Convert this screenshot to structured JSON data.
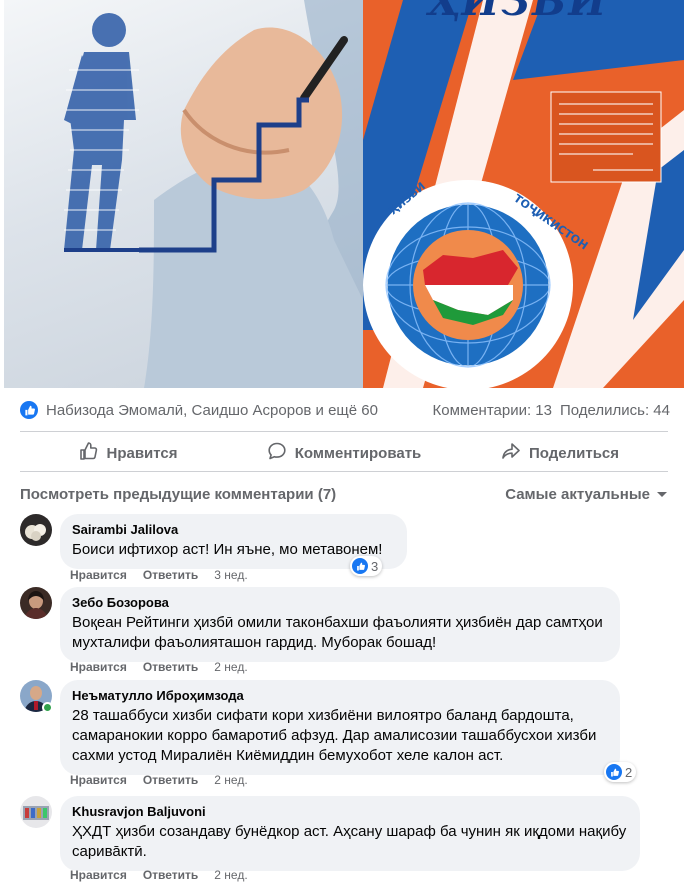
{
  "post_image": {
    "logo_title": "ҲИЗБИ",
    "alt": ""
  },
  "stats": {
    "reactions_text": "Набизода Эмомалӣ, Саидшо Асроров и ещё 60",
    "comments_text": "Комментарии: 13",
    "shares_text": "Поделились: 44"
  },
  "actions": {
    "like_label": "Нравится",
    "comment_label": "Комментировать",
    "share_label": "Поделиться"
  },
  "comments_header": {
    "previous_label": "Посмотреть предыдущие комментарии (7)",
    "sort_label": "Самые актуальные"
  },
  "comments": [
    {
      "author": "Sairambi Jalilova",
      "text": "Боиси ифтихор аст! Ин яъне, мо метавонем!",
      "like_label": "Нравится",
      "reply_label": "Ответить",
      "time": "3 нед.",
      "reactions": "3"
    },
    {
      "author": "Зебо Бозорова",
      "text_lines": [
        "Воқеан Рейтинги ҳизбӣ омили таконбахши фаъолияти ҳизбиён дар самтҳои",
        "мухталифи фаъолияташон гардид. Муборак бошад!"
      ],
      "like_label": "Нравится",
      "reply_label": "Ответить",
      "time": "2 нед."
    },
    {
      "author": "Неъматулло Иброҳимзода",
      "text_lines": [
        "28 ташаббуси хизби сифати кори хизбиёни вилоятро баланд бардошта,",
        "самаранокии корро бамаротиб афзуд. Дар амалисозии ташаббусхои хизби",
        "сахми устод Миралиён Киёмиддин бемухобот хеле калон аст."
      ],
      "like_label": "Нравится",
      "reply_label": "Ответить",
      "time": "2 нед.",
      "reactions": "2"
    },
    {
      "author": "Khusravjon Baljuvoni",
      "text_lines": [
        "ҲХДТ ҳизби созандаву бунёдкор аст. Аҳсану шараф ба чунин як иқдоми нақибу",
        "сарива̄ктӣ."
      ],
      "like_label": "Нравится",
      "reply_label": "Ответить",
      "time": "2 нед."
    }
  ],
  "colors": {
    "accent": "#1877f2",
    "muted_text": "#65676b",
    "bubble_bg": "#f0f2f5",
    "online": "#31a24c",
    "poster_orange": "#e9612a",
    "poster_blue": "#1e5fb3"
  }
}
